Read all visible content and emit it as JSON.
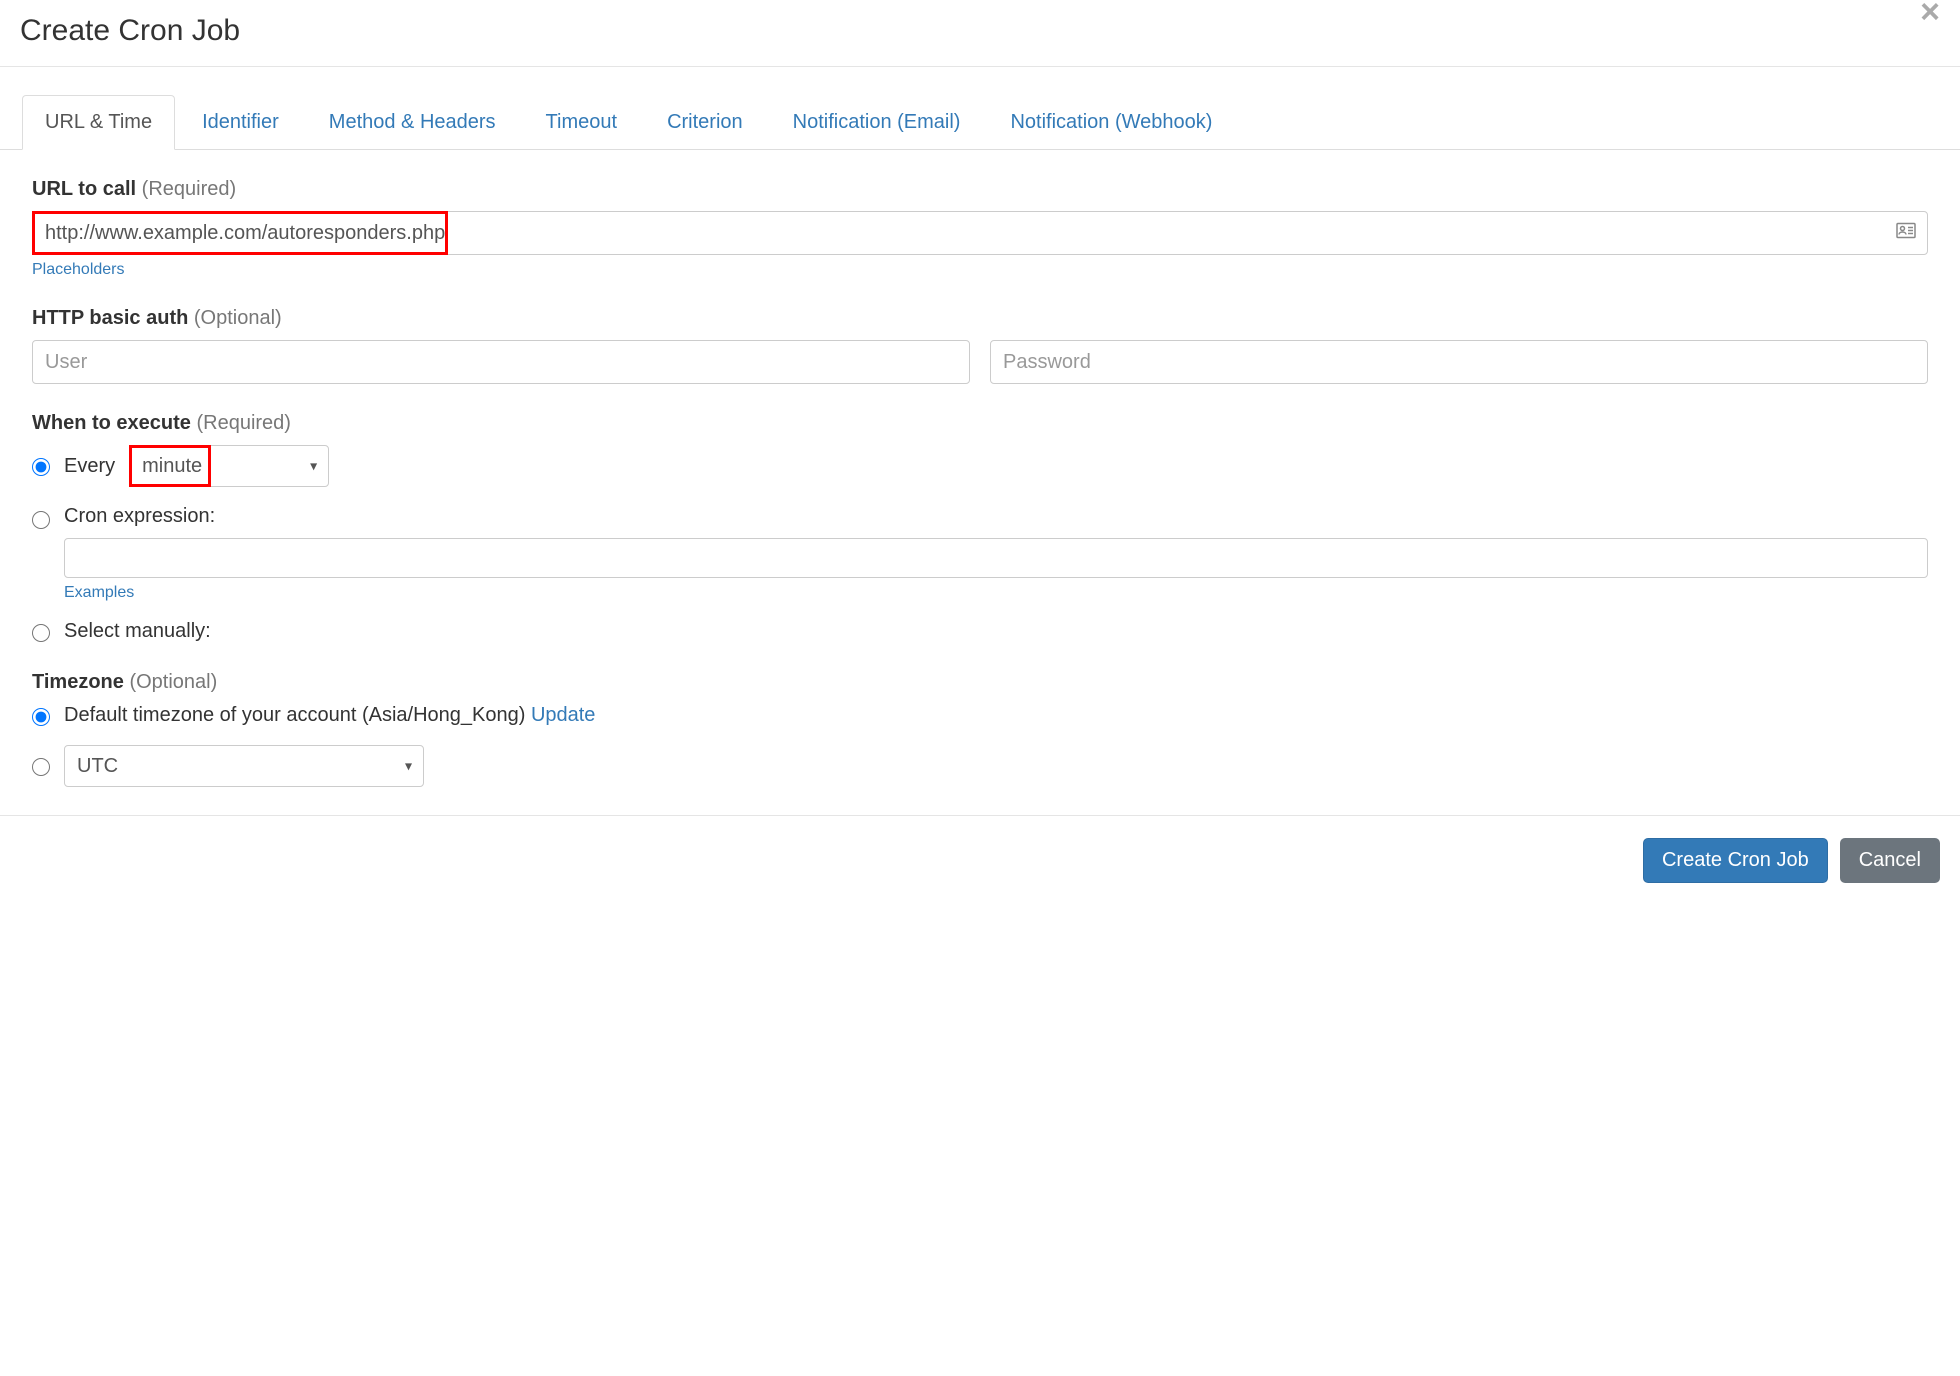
{
  "header": {
    "title": "Create Cron Job"
  },
  "tabs": [
    {
      "label": "URL & Time",
      "active": true
    },
    {
      "label": "Identifier",
      "active": false
    },
    {
      "label": "Method & Headers",
      "active": false
    },
    {
      "label": "Timeout",
      "active": false
    },
    {
      "label": "Criterion",
      "active": false
    },
    {
      "label": "Notification (Email)",
      "active": false
    },
    {
      "label": "Notification (Webhook)",
      "active": false
    }
  ],
  "url_section": {
    "label": "URL to call",
    "hint": "(Required)",
    "value": "http://www.example.com/autoresponders.php",
    "placeholders_link": "Placeholders"
  },
  "auth_section": {
    "label": "HTTP basic auth",
    "hint": "(Optional)",
    "user_placeholder": "User",
    "password_placeholder": "Password"
  },
  "when_section": {
    "label": "When to execute",
    "hint": "(Required)",
    "every_label": "Every",
    "every_value": "minute",
    "cron_label": "Cron expression:",
    "examples_link": "Examples",
    "select_manually_label": "Select manually:"
  },
  "timezone_section": {
    "label": "Timezone",
    "hint": "(Optional)",
    "default_label": "Default timezone of your account (Asia/Hong_Kong) ",
    "update_link": "Update",
    "tz_value": "UTC"
  },
  "footer": {
    "primary": "Create Cron Job",
    "cancel": "Cancel"
  }
}
